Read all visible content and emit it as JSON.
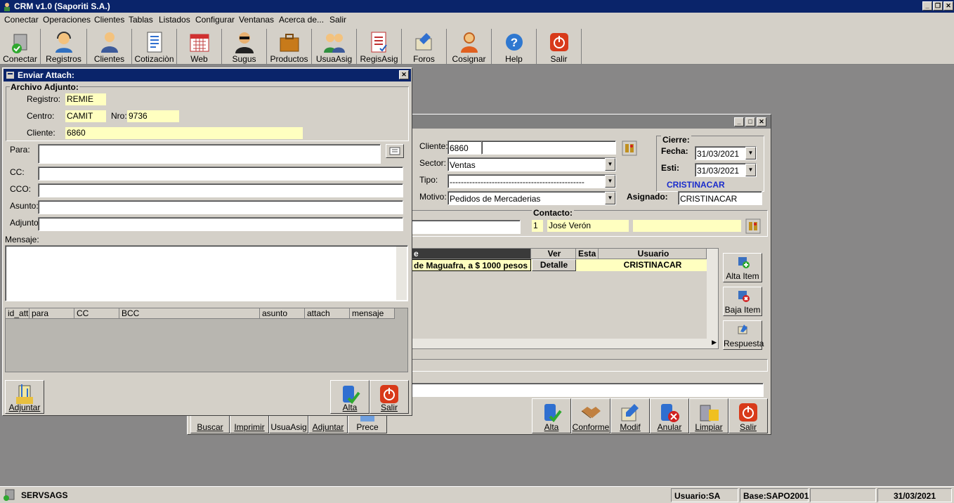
{
  "window": {
    "title": "CRM v1.0 (Saporiti S.A.)"
  },
  "menu": [
    "Conectar",
    "Operaciones",
    "Clientes",
    "Tablas",
    "Listados",
    "Configurar",
    "Ventanas",
    "Acerca de...",
    "Salir"
  ],
  "toolbar": [
    "Conectar",
    "Registros",
    "Clientes",
    "Cotizaciòn",
    "Web",
    "Sugus",
    "Productos",
    "UsuaAsig",
    "RegisAsig",
    "Foros",
    "Cosignar",
    "Help",
    "Salir"
  ],
  "back_form": {
    "cliente_label": "Cliente:",
    "cliente_code": "6860",
    "cliente_name": "",
    "sector_label": "Sector:",
    "sector": "Ventas",
    "tipo_label": "Tipo:",
    "tipo": "------------------------------------------------",
    "motivo_label": "Motivo:",
    "motivo": "Pedidos de Mercaderias",
    "cierre_label": "Cierre:",
    "fecha_label": "Fecha:",
    "fecha": "31/03/2021",
    "esti_label": "Esti:",
    "esti": "31/03/2021",
    "user_link": "CRISTINACAR",
    "asignado_label": "Asignado:",
    "asignado": "CRISTINACAR",
    "contacto_label": "Contacto:",
    "contacto_num": "1",
    "contacto_name": "José Verón",
    "contacto_extra": "",
    "grid_headers": [
      "e",
      "Ver",
      "Esta",
      "Usuario"
    ],
    "grid_row": {
      "desc": "de Maguafra, a $ 1000 pesos",
      "ver": "Detalle",
      "esta": "",
      "usuario": "CRISTINACAR"
    },
    "side_buttons": [
      "Alta Item",
      "Baja Item",
      "Respuesta"
    ],
    "bottom_left_buttons": [
      "Buscar",
      "Imprimir",
      "UsuaAsig",
      "Adjuntar",
      "Prece"
    ],
    "bottom_right_buttons": [
      "Alta",
      "Conforme",
      "Modif",
      "Anular",
      "Limpiar",
      "Salir"
    ]
  },
  "attach_dialog": {
    "title": "Enviar Attach:",
    "group": "Archivo Adjunto:",
    "registro_label": "Registro:",
    "registro": "REMIE",
    "centro_label": "Centro:",
    "centro": "CAMIT",
    "nro_label": "Nro:",
    "nro": "9736",
    "cliente_label": "Cliente:",
    "cliente": "6860",
    "para_label": "Para:",
    "para": "",
    "cc_label": "CC:",
    "cc": "",
    "cco_label": "CCO:",
    "cco": "",
    "asunto_label": "Asunto:",
    "asunto": "",
    "adjunto_label": "Adjunto:",
    "adjunto": "",
    "mensaje_label": "Mensaje:",
    "mensaje": "",
    "columns": [
      "id_att",
      "para",
      "CC",
      "BCC",
      "asunto",
      "attach",
      "mensaje"
    ],
    "btn_adjuntar": "Adjuntar",
    "btn_alta": "Alta",
    "btn_salir": "Salir"
  },
  "status": {
    "server": "SERVSAGS",
    "usuario": "Usuario:SA",
    "base": "Base:SAPO2001",
    "empty": "",
    "date": "31/03/2021"
  },
  "colors": {
    "title_bar": "#0a246a",
    "face": "#d4d0c8",
    "desktop": "#888787",
    "yellow_field": "#ffffc0",
    "link_blue": "#1a2ccc"
  }
}
